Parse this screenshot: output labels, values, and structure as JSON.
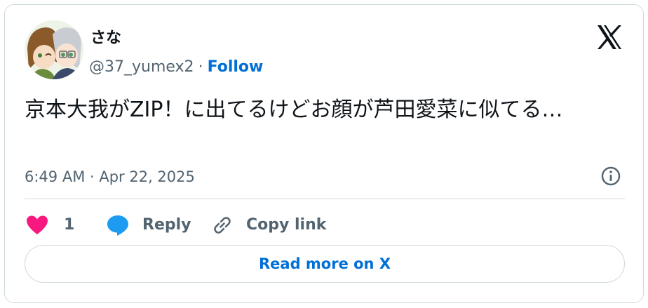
{
  "author": {
    "display_name": "さな",
    "handle": "@37_yumex2",
    "separator": "·",
    "follow_label": "Follow"
  },
  "tweet": {
    "text": "京本大我がZIP！に出てるけどお顔が芦田愛菜に似てる…",
    "timestamp": "6:49 AM · Apr 22, 2025"
  },
  "actions": {
    "like_count": "1",
    "reply_label": "Reply",
    "copy_link_label": "Copy link"
  },
  "read_more_label": "Read more on X",
  "icons": {
    "logo": "x-logo-icon",
    "info": "info-icon",
    "like": "heart-icon",
    "reply": "speech-bubble-icon",
    "copy": "link-icon"
  },
  "colors": {
    "accent": "#006fd6",
    "like": "#f91880",
    "reply": "#1d9bf0",
    "muted": "#536471",
    "border": "#cfd9de",
    "text": "#0f1419"
  }
}
